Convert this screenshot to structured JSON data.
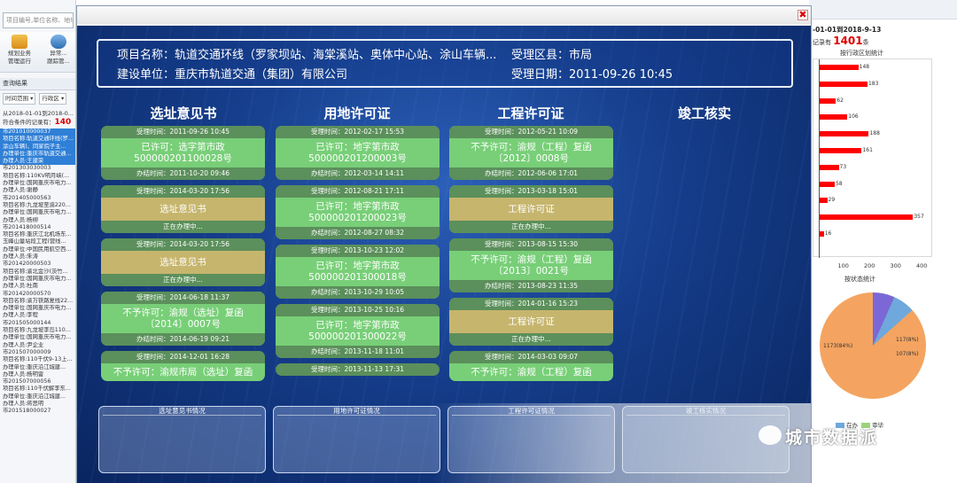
{
  "left_panel": {
    "search_placeholder": "项目编号,单位名称、地址",
    "tool1": "规划业务\n管理运行",
    "tool2": "异常...\n跟踪管...",
    "result_label": "查询结果",
    "filter1": "时间范围 ▾",
    "filter2": "行政区 ▾",
    "date_range": "从2018-01-01到2018-0...",
    "count_text": "符合条件的记录有：",
    "count_value": "140",
    "rows": [
      {
        "t": "市201010000037",
        "sel": true
      },
      {
        "t": "项目名称:轨道交通环线(罗...",
        "sel": true
      },
      {
        "t": "涂山车辆)、同家院子主...",
        "sel": true
      },
      {
        "t": "办理单位:重庆市轨道交通...",
        "sel": true
      },
      {
        "t": "办理人员:王建荣",
        "sel": true
      },
      {
        "t": "市201303030003",
        "sel": false
      },
      {
        "t": "项目名称:110KV明月峡(...",
        "sel": false
      },
      {
        "t": "办理单位:国网重庆市电力...",
        "sel": false
      },
      {
        "t": "办理人员:谢静",
        "sel": false
      },
      {
        "t": "市201405000563",
        "sel": false
      },
      {
        "t": "项目名称:九龙坡至渝220...",
        "sel": false
      },
      {
        "t": "办理单位:国网重庆市电力...",
        "sel": false
      },
      {
        "t": "办理人员:杨柳",
        "sel": false
      },
      {
        "t": "市201418000514",
        "sel": false
      },
      {
        "t": "项目名称:重庆江北机场东...",
        "sel": false
      },
      {
        "t": "玉峰山量站段工程(营线...",
        "sel": false
      },
      {
        "t": "办理单位:中国民用航空西...",
        "sel": false
      },
      {
        "t": "办理人员:朱涛",
        "sel": false
      },
      {
        "t": "市201420000503",
        "sel": false
      },
      {
        "t": "项目名称:渝北金沙(茨竹...",
        "sel": false
      },
      {
        "t": "办理单位:国网重庆市电力...",
        "sel": false
      },
      {
        "t": "办理人员:杜南",
        "sel": false
      },
      {
        "t": "市201420000570",
        "sel": false
      },
      {
        "t": "项目名称:渝万铁路复线22...",
        "sel": false
      },
      {
        "t": "办理单位:国网重庆市电力...",
        "sel": false
      },
      {
        "t": "办理人员:李程",
        "sel": false
      },
      {
        "t": "市201505000144",
        "sel": false
      },
      {
        "t": "项目名称:九龙坡李岛110...",
        "sel": false
      },
      {
        "t": "办理单位:国网重庆市电力...",
        "sel": false
      },
      {
        "t": "办理人员:尹企业",
        "sel": false
      },
      {
        "t": "市201507000009",
        "sel": false
      },
      {
        "t": "项目名称:110千伏9-13上...",
        "sel": false
      },
      {
        "t": "办理单位:重庆沿江城建...",
        "sel": false
      },
      {
        "t": "办理人员:杨明雷",
        "sel": false
      },
      {
        "t": "市201507000056",
        "sel": false
      },
      {
        "t": "项目名称:110千伏解李东...",
        "sel": false
      },
      {
        "t": "办理单位:重庆沿江城建...",
        "sel": false
      },
      {
        "t": "办理人员:蒋思明",
        "sel": false
      },
      {
        "t": "市201518000027",
        "sel": false
      }
    ]
  },
  "right_panel": {
    "date_range": "-01-01到2018-9-13",
    "count_label": "记录有",
    "count_value": "1401",
    "count_unit": "条",
    "bar_title": "按行政区划统计",
    "bars": [
      148,
      183,
      62,
      106,
      188,
      161,
      73,
      58,
      29,
      357,
      16
    ],
    "x_ticks": [
      "100",
      "200",
      "300",
      "400"
    ],
    "x_max": 400,
    "pie_title": "按状态统计",
    "pie_labels": [
      "1173(84%)",
      "117(8%)",
      "107(8%)"
    ],
    "legend": [
      "在办",
      "审毕"
    ]
  },
  "modal": {
    "close_label": "✖",
    "info": {
      "project_label": "项目名称：",
      "project_value": "轨道交通环线（罗家坝站、海棠溪站、奥体中心站、涂山车辆...",
      "district_label": "受理区县：",
      "district_value": "市局",
      "unit_label": "建设单位：",
      "unit_value": "重庆市轨道交通（集团）有限公司",
      "date_label": "受理日期：",
      "date_value": "2011-09-26 10:45"
    },
    "stages": [
      "选址意见书",
      "用地许可证",
      "工程许可证",
      "竣工核实"
    ],
    "columns": [
      [
        {
          "top": "受理时间：2011-09-26 10:45",
          "body": "已许可：选字第市政\n500000201100028号",
          "bottom": "办结时间：2011-10-20 09:46",
          "pending": false
        },
        {
          "top": "受理时间：2014-03-20 17:56",
          "body": "选址意见书",
          "bottom": "正在办理中...",
          "pending": true
        },
        {
          "top": "受理时间：2014-03-20 17:56",
          "body": "选址意见书",
          "bottom": "正在办理中...",
          "pending": true
        },
        {
          "top": "受理时间：2014-06-18 11:37",
          "body": "不予许可：渝规（选址）复函\n〔2014〕0007号",
          "bottom": "办结时间：2014-06-19 09:21",
          "pending": false
        },
        {
          "top": "受理时间：2014-12-01 16:28",
          "body": "不予许可：渝规市局（选址）复函",
          "bottom": "",
          "pending": false
        }
      ],
      [
        {
          "top": "受理时间：2012-02-17 15:53",
          "body": "已许可：地字第市政\n500000201200003号",
          "bottom": "办结时间：2012-03-14 14:11",
          "pending": false
        },
        {
          "top": "受理时间：2012-08-21 17:11",
          "body": "已许可：地字第市政\n500000201200023号",
          "bottom": "办结时间：2012-08-27 08:32",
          "pending": false
        },
        {
          "top": "受理时间：2013-10-23 12:02",
          "body": "已许可：地字第市政\n500000201300018号",
          "bottom": "办结时间：2013-10-29 10:05",
          "pending": false
        },
        {
          "top": "受理时间：2013-10-25 10:16",
          "body": "已许可：地字第市政\n500000201300022号",
          "bottom": "办结时间：2013-11-18 11:01",
          "pending": false
        },
        {
          "top": "受理时间：2013-11-13 17:31",
          "body": "",
          "bottom": "",
          "pending": false
        }
      ],
      [
        {
          "top": "受理时间：2012-05-21 10:09",
          "body": "不予许可：渝规（工程）复函\n〔2012〕0008号",
          "bottom": "办结时间：2012-06-06 17:01",
          "pending": false
        },
        {
          "top": "受理时间：2013-03-18 15:01",
          "body": "工程许可证",
          "bottom": "正在办理中...",
          "pending": true
        },
        {
          "top": "受理时间：2013-08-15 15:30",
          "body": "不予许可：渝规（工程）复函\n〔2013〕0021号",
          "bottom": "办结时间：2013-08-23 11:35",
          "pending": false
        },
        {
          "top": "受理时间：2014-01-16 15:23",
          "body": "工程许可证",
          "bottom": "正在办理中...",
          "pending": true
        },
        {
          "top": "受理时间：2014-03-03 09:07",
          "body": "不予许可：渝规（工程）复函",
          "bottom": "",
          "pending": false
        }
      ],
      []
    ],
    "status_titles": [
      "选址意见书情况",
      "用地许可证情况",
      "工程许可证情况",
      "竣工核实情况"
    ]
  },
  "watermark": "城市数据派"
}
